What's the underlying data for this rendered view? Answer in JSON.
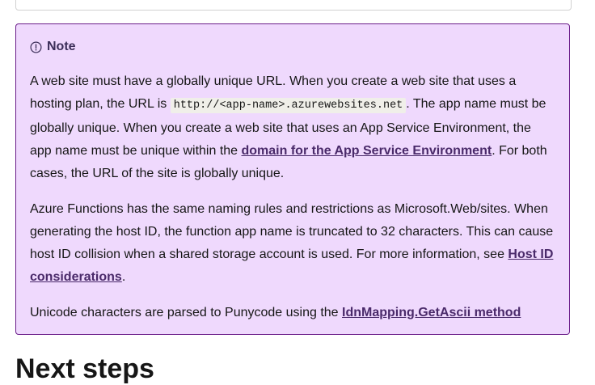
{
  "note": {
    "title": "Note",
    "icon": "info-circle-icon",
    "p1": {
      "t1": "A web site must have a globally unique URL. When you create a web site that uses a hosting plan, the URL is ",
      "code": "http://<app-name>.azurewebsites.net",
      "t2": ". The app name must be globally unique. When you create a web site that uses an App Service Environment, the app name must be unique within the ",
      "link": "domain for the App Service Environment",
      "t3": ". For both cases, the URL of the site is globally unique."
    },
    "p2": {
      "t1": "Azure Functions has the same naming rules and restrictions as Microsoft.Web/sites. When generating the host ID, the function app name is truncated to 32 characters. This can cause host ID collision when a shared storage account is used. For more information, see ",
      "link": "Host ID considerations",
      "t2": "."
    },
    "p3": {
      "t1": "Unicode characters are parsed to Punycode using the ",
      "link": "IdnMapping.GetAscii method"
    }
  },
  "next_heading": "Next steps"
}
